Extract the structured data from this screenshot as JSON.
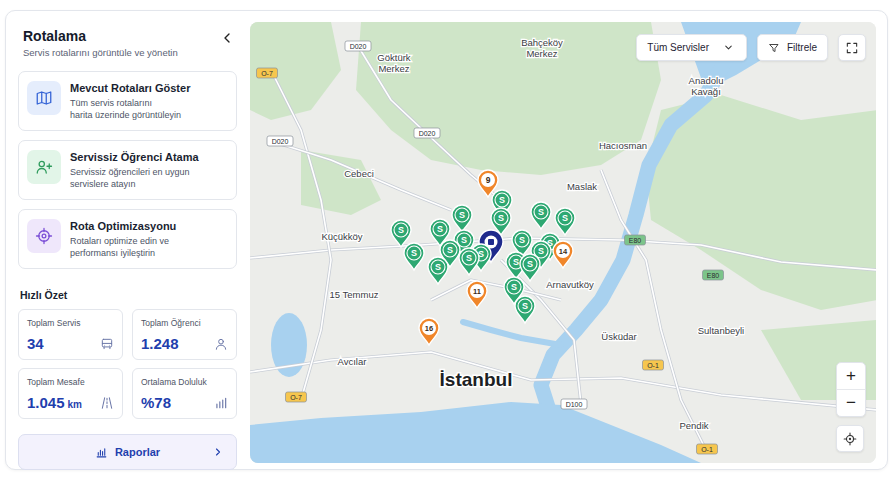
{
  "sidebar": {
    "title": "Rotalama",
    "subtitle": "Servis rotalarını görüntüle ve yönetin",
    "actions": [
      {
        "title": "Mevcut Rotaları Göster",
        "desc_lines": [
          "Tüm servis rotalarını",
          "harita üzerinde görüntüleyin"
        ]
      },
      {
        "title": "Servissiz Öğrenci Atama",
        "desc_lines": [
          "Servissiz öğrencileri en uygun",
          "servislere atayın"
        ]
      },
      {
        "title": "Rota Optimizasyonu",
        "desc_lines": [
          "Rotaları optimize edin ve",
          "performansı iyileştirin"
        ]
      }
    ]
  },
  "summary": {
    "title": "Hızlı Özet",
    "stats": [
      {
        "label": "Toplam Servis",
        "value": "34",
        "unit": ""
      },
      {
        "label": "Toplam Öğrenci",
        "value": "1.248",
        "unit": ""
      },
      {
        "label": "Toplam Mesafe",
        "value": "1.045",
        "unit": "km"
      },
      {
        "label": "Ortalama Doluluk",
        "value": "%78",
        "unit": ""
      }
    ]
  },
  "reports_button": {
    "label": "Raporlar"
  },
  "map": {
    "service_filter": "Tüm Servisler",
    "filter_button": "Filtrele",
    "zoom_in": "+",
    "zoom_out": "−",
    "places": [
      {
        "lines": [
          "Göktürk",
          "Merkez"
        ],
        "kind": "district"
      },
      {
        "lines": [
          "Bahçeköy",
          "Merkez"
        ],
        "kind": "district"
      },
      {
        "lines": [
          "Anadolu",
          "Kavağı"
        ],
        "kind": "district"
      },
      {
        "lines": [
          "Hacıosman"
        ],
        "kind": "district"
      },
      {
        "lines": [
          "Cebeci"
        ],
        "kind": "district"
      },
      {
        "lines": [
          "Maslak"
        ],
        "kind": "district"
      },
      {
        "lines": [
          "Küçükköy"
        ],
        "kind": "district"
      },
      {
        "lines": [
          "Arnavutköy"
        ],
        "kind": "district"
      },
      {
        "lines": [
          "15 Temmuz"
        ],
        "kind": "district"
      },
      {
        "lines": [
          "Sultanbeyli"
        ],
        "kind": "district"
      },
      {
        "lines": [
          "Üsküdar"
        ],
        "kind": "district"
      },
      {
        "lines": [
          "Avcılar"
        ],
        "kind": "district"
      },
      {
        "lines": [
          "İstanbul"
        ],
        "kind": "city"
      },
      {
        "lines": [
          "Pendik"
        ],
        "kind": "district"
      }
    ],
    "road_labels": [
      {
        "text": "D020",
        "color": "#ffffff"
      },
      {
        "text": "D020",
        "color": "#ffffff"
      },
      {
        "text": "O-7",
        "color": "#f6c64e"
      },
      {
        "text": "D020",
        "color": "#ffffff"
      },
      {
        "text": "O-7",
        "color": "#f6c64e"
      },
      {
        "text": "D100",
        "color": "#ffffff"
      },
      {
        "text": "O-1",
        "color": "#f6c64e"
      },
      {
        "text": "E80",
        "color": "#7cc48a"
      },
      {
        "text": "E80",
        "color": "#7cc48a"
      },
      {
        "text": "O-1",
        "color": "#f6c64e"
      }
    ],
    "pins": [
      {
        "label": "S",
        "kind": "service",
        "color": "#2ea872"
      },
      {
        "label": "S",
        "kind": "service",
        "color": "#2ea872"
      },
      {
        "label": "S",
        "kind": "service",
        "color": "#2ea872"
      },
      {
        "label": "S",
        "kind": "service",
        "color": "#2ea872"
      },
      {
        "label": "S",
        "kind": "service",
        "color": "#2ea872"
      },
      {
        "label": "S",
        "kind": "service",
        "color": "#2ea872"
      },
      {
        "label": "S",
        "kind": "service",
        "color": "#2ea872"
      },
      {
        "label": "S",
        "kind": "service",
        "color": "#2ea872"
      },
      {
        "label": "S",
        "kind": "service",
        "color": "#2ea872"
      },
      {
        "label": "S",
        "kind": "service",
        "color": "#2ea872"
      },
      {
        "label": "S",
        "kind": "service",
        "color": "#2ea872"
      },
      {
        "label": "S",
        "kind": "service",
        "color": "#2ea872"
      },
      {
        "label": "S",
        "kind": "service",
        "color": "#2ea872"
      },
      {
        "label": "S",
        "kind": "service",
        "color": "#2ea872"
      },
      {
        "label": "S",
        "kind": "service",
        "color": "#2ea872"
      },
      {
        "label": "S",
        "kind": "service",
        "color": "#2ea872"
      },
      {
        "label": "S",
        "kind": "service",
        "color": "#2ea872"
      },
      {
        "label": "S",
        "kind": "service",
        "color": "#2ea872"
      },
      {
        "label": "S",
        "kind": "service",
        "color": "#2ea872"
      },
      {
        "label": "S",
        "kind": "service",
        "color": "#2ea872"
      },
      {
        "label": "9",
        "kind": "numbered",
        "color": "#f0862a"
      },
      {
        "label": "14",
        "kind": "numbered",
        "color": "#f0862a"
      },
      {
        "label": "11",
        "kind": "numbered",
        "color": "#f0862a"
      },
      {
        "label": "16",
        "kind": "numbered",
        "color": "#f0862a"
      },
      {
        "label": "",
        "kind": "school",
        "color": "#1f2a8c"
      }
    ]
  }
}
